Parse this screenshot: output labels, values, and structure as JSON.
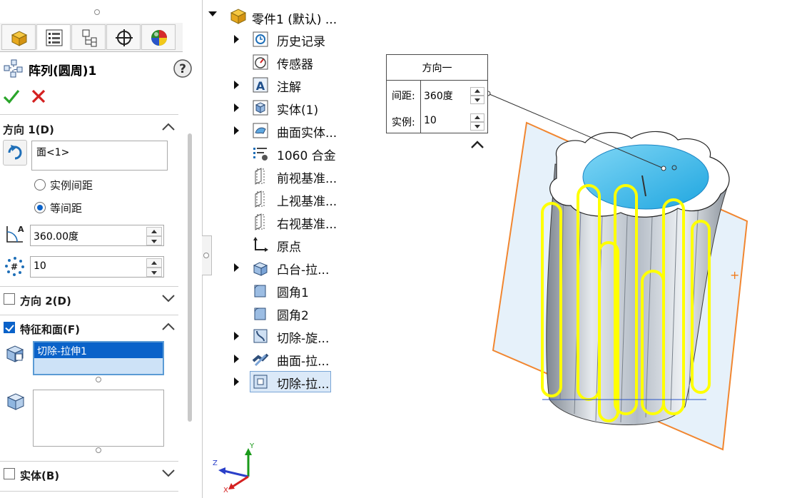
{
  "property_manager": {
    "feature_title": "阵列(圆周)1",
    "help_icon": "help-icon",
    "ok_icon": "check-icon",
    "cancel_icon": "close-icon",
    "tabs": [
      {
        "name": "featuremanager-tab",
        "icon": "part-tree-icon"
      },
      {
        "name": "propertymanager-tab",
        "icon": "property-list-icon"
      },
      {
        "name": "configuration-tab",
        "icon": "configuration-icon"
      },
      {
        "name": "dimxpert-tab",
        "icon": "crosshair-icon"
      },
      {
        "name": "appearance-tab",
        "icon": "appearance-sphere-icon"
      }
    ],
    "direction1": {
      "title": "方向 1(D)",
      "reference": "面<1>",
      "option_instance_spacing": "实例间距",
      "option_equal_spacing": "等间距",
      "selected_option": "等间距",
      "angle": "360.00度",
      "count": "10"
    },
    "direction2": {
      "title": "方向 2(D)",
      "checked": false
    },
    "features_faces": {
      "title": "特征和面(F)",
      "checked": true,
      "features": [
        "切除-拉伸1"
      ],
      "faces": []
    },
    "bodies": {
      "title": "实体(B)",
      "checked": false
    }
  },
  "feature_tree": {
    "root": "零件1 (默认) ...",
    "items": [
      {
        "label": "历史记录",
        "expandable": true,
        "icon": "history-icon"
      },
      {
        "label": "传感器",
        "expandable": false,
        "icon": "sensor-icon"
      },
      {
        "label": "注解",
        "expandable": true,
        "icon": "annotation-icon"
      },
      {
        "label": "实体(1)",
        "expandable": true,
        "icon": "solid-body-icon"
      },
      {
        "label": "曲面实体...",
        "expandable": true,
        "icon": "surface-body-icon"
      },
      {
        "label": "1060 合金",
        "expandable": false,
        "icon": "material-icon"
      },
      {
        "label": "前视基准...",
        "expandable": false,
        "icon": "plane-icon"
      },
      {
        "label": "上视基准...",
        "expandable": false,
        "icon": "plane-icon"
      },
      {
        "label": "右视基准...",
        "expandable": false,
        "icon": "plane-icon"
      },
      {
        "label": "原点",
        "expandable": false,
        "icon": "origin-icon"
      },
      {
        "label": "凸台-拉...",
        "expandable": true,
        "icon": "boss-extrude-icon"
      },
      {
        "label": "圆角1",
        "expandable": false,
        "icon": "fillet-icon"
      },
      {
        "label": "圆角2",
        "expandable": false,
        "icon": "fillet-icon"
      },
      {
        "label": "切除-旋...",
        "expandable": true,
        "icon": "cut-revolve-icon"
      },
      {
        "label": "曲面-拉...",
        "expandable": true,
        "icon": "surface-extrude-icon"
      },
      {
        "label": "切除-拉...",
        "expandable": true,
        "icon": "cut-extrude-icon",
        "selected": true
      }
    ]
  },
  "callout": {
    "title": "方向一",
    "spacing_label": "间距:",
    "spacing_value": "360度",
    "count_label": "实例:",
    "count_value": "10"
  },
  "triad": {
    "x": "X",
    "y": "Y",
    "z": "Z"
  },
  "colors": {
    "selection_blue": "#0a62c9",
    "preview_yellow": "#ffff00",
    "plane_orange": "#f07a1a",
    "face_cyan": "#34b8ee"
  }
}
